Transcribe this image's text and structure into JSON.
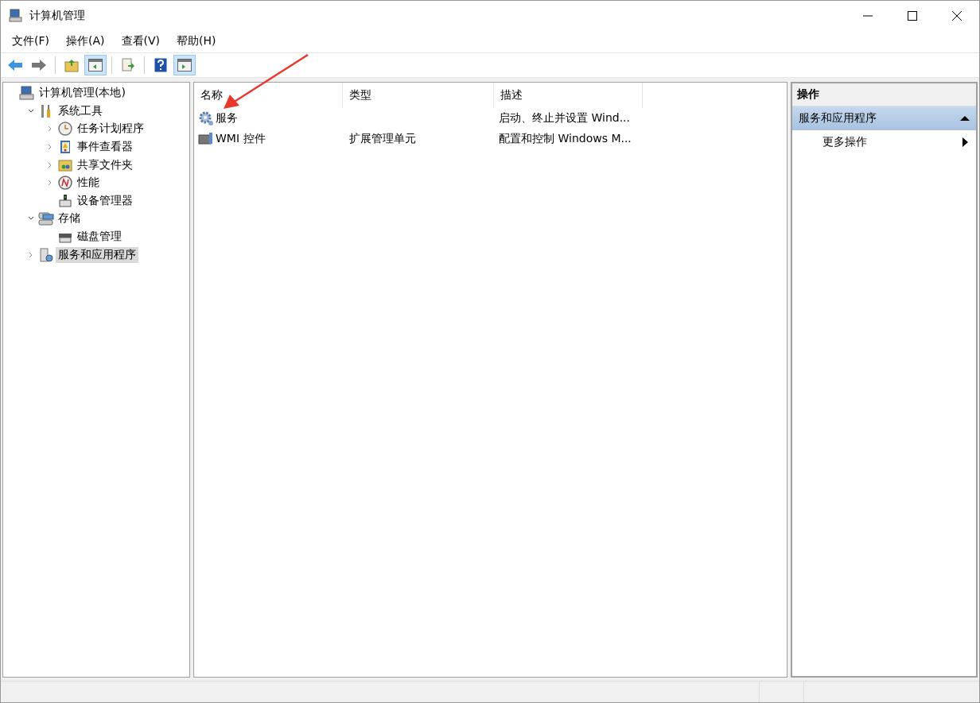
{
  "window": {
    "title": "计算机管理"
  },
  "menu": [
    "文件(F)",
    "操作(A)",
    "查看(V)",
    "帮助(H)"
  ],
  "toolbar": [
    {
      "kind": "back",
      "pressed": false
    },
    {
      "kind": "forward",
      "pressed": false
    },
    {
      "kind": "sep"
    },
    {
      "kind": "up",
      "pressed": false
    },
    {
      "kind": "tree",
      "pressed": true
    },
    {
      "kind": "sep"
    },
    {
      "kind": "export",
      "pressed": false
    },
    {
      "kind": "sep"
    },
    {
      "kind": "help",
      "pressed": false
    },
    {
      "kind": "pane",
      "pressed": true
    }
  ],
  "tree": [
    {
      "label": "计算机管理(本地)",
      "selected": false,
      "children": [
        {
          "label": "系统工具",
          "selected": false,
          "expanded": true,
          "children": [
            {
              "label": "任务计划程序",
              "selected": false,
              "expanded": false
            },
            {
              "label": "事件查看器",
              "selected": false,
              "expanded": false
            },
            {
              "label": "共享文件夹",
              "selected": false,
              "expanded": false
            },
            {
              "label": "性能",
              "selected": false,
              "expanded": false
            },
            {
              "label": "设备管理器",
              "selected": false
            }
          ]
        },
        {
          "label": "存储",
          "selected": false,
          "expanded": true,
          "children": [
            {
              "label": "磁盘管理",
              "selected": false
            }
          ]
        },
        {
          "label": "服务和应用程序",
          "selected": true,
          "expanded": false
        }
      ]
    }
  ],
  "table": {
    "columns": [
      "名称",
      "类型",
      "描述"
    ],
    "rows": [
      {
        "cells": [
          "服务",
          "",
          "启动、终止并设置 Wind..."
        ]
      },
      {
        "cells": [
          "WMI 控件",
          "扩展管理单元",
          "配置和控制 Windows M..."
        ]
      }
    ]
  },
  "actions": {
    "title": "操作",
    "section": {
      "label": "服务和应用程序",
      "expanded": true
    },
    "items": [
      "更多操作"
    ]
  }
}
